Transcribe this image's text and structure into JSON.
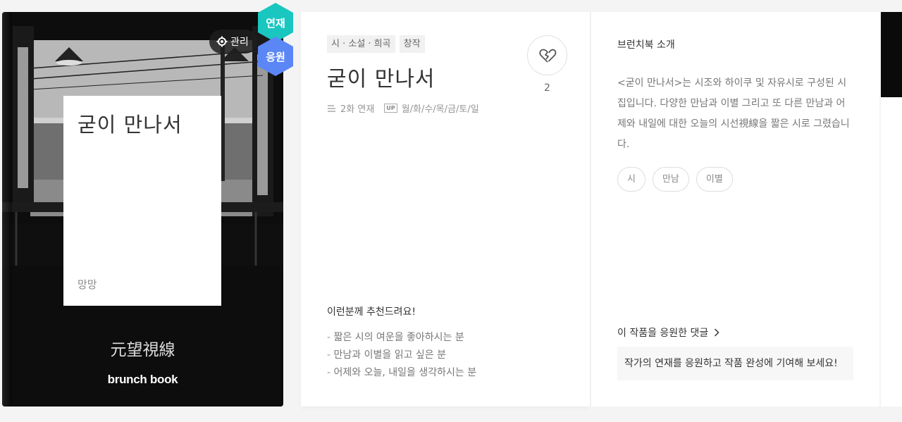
{
  "cover": {
    "title": "굳이 만나서",
    "author": "망망",
    "publisher": "元望視線",
    "brand": "brunch book",
    "manage_label": "관리",
    "badge_serial": "연재",
    "badge_support": "응원"
  },
  "book": {
    "tags": [
      "시 · 소설 · 희곡",
      "창작"
    ],
    "title": "굳이 만나서",
    "episodes": "2화 연재",
    "up_label": "UP",
    "schedule": "월/화/수/목/금/토/일",
    "likes": "2",
    "recommend_title": "이런분께 추천드려요!",
    "recommend_items": [
      "짧은 시의 여운을 좋아하시는 분",
      "만남과 이별을 읽고 싶은 분",
      "어제와 오늘, 내일을 생각하시는 분"
    ]
  },
  "intro": {
    "label": "브런치북 소개",
    "text": "<굳이 만나서>는 시조와 하이쿠 및 자유시로 구성된 시집입니다. 다양한 만남과 이별 그리고 또 다른 만남과 어제와 내일에 대한 오늘의 시선視線을 짧은 시로 그렸습니다.",
    "keywords": [
      "시",
      "만남",
      "이별"
    ],
    "comments_link": "이 작품을 응원한 댓글",
    "support_prompt": "작가의 연재를 응원하고 작품 완성에 기여해 보세요!"
  },
  "colors": {
    "serial_badge": "#1ac6c0",
    "support_badge": "#5b86f6"
  }
}
